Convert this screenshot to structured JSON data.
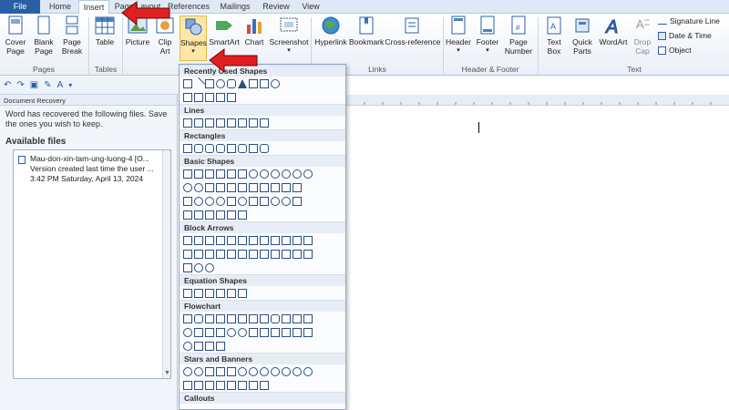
{
  "tabs": [
    "File",
    "Home",
    "Insert",
    "Page Layout",
    "References",
    "Mailings",
    "Review",
    "View"
  ],
  "active_tab": "Insert",
  "ribbon": {
    "pages": {
      "cover": "Cover Page",
      "blank": "Blank Page",
      "break": "Page Break",
      "label": "Pages"
    },
    "tables": {
      "table": "Table",
      "label": "Tables"
    },
    "illus": {
      "picture": "Picture",
      "clipart": "Clip Art",
      "shapes": "Shapes",
      "smartart": "SmartArt",
      "chart": "Chart",
      "screenshot": "Screenshot"
    },
    "links": {
      "hyperlink": "Hyperlink",
      "bookmark": "Bookmark",
      "crossref": "Cross-reference",
      "label": "Links"
    },
    "hf": {
      "header": "Header",
      "footer": "Footer",
      "pagenum": "Page Number",
      "label": "Header & Footer"
    },
    "text": {
      "textbox": "Text Box",
      "quickparts": "Quick Parts",
      "wordart": "WordArt",
      "dropcap": "Drop Cap",
      "label": "Text",
      "sigline": "Signature Line",
      "datetime": "Date & Time",
      "object": "Object"
    }
  },
  "recovery": {
    "header": "Document Recovery",
    "message": "Word has recovered the following files.  Save the ones you wish to keep.",
    "available": "Available files",
    "file_name": "Mau-don-xin-tam-ung-luong-4  [O...",
    "file_desc": "Version created last time the user ...",
    "file_time": "3:42 PM Saturday, April 13, 2024"
  },
  "shapes_menu": {
    "sections": [
      "Recently Used Shapes",
      "Lines",
      "Rectangles",
      "Basic Shapes",
      "Block Arrows",
      "Equation Shapes",
      "Flowchart",
      "Stars and Banners",
      "Callouts"
    ]
  },
  "colors": {
    "accent": "#2a5fa8",
    "annotation": "#e02020"
  }
}
